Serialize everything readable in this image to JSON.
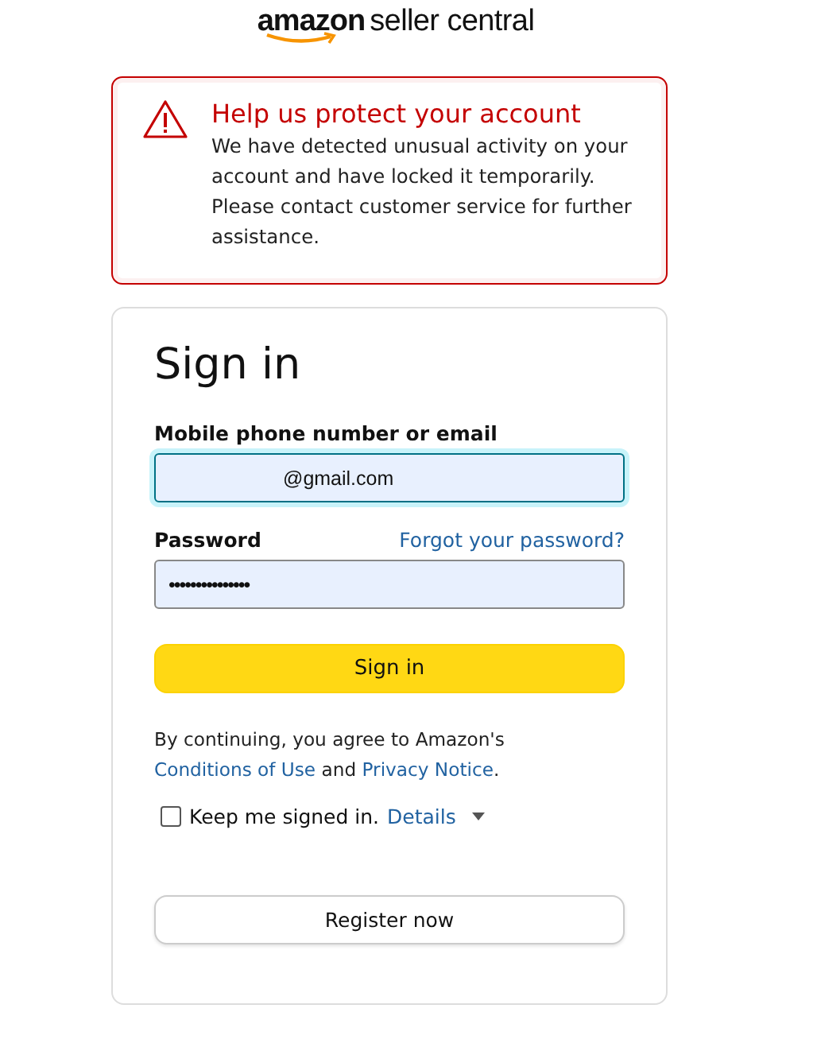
{
  "logo": {
    "brand": "amazon",
    "product": "seller central"
  },
  "alert": {
    "title": "Help us protect your account",
    "message": "We have detected unusual activity on your account and have locked it temporarily. Please contact customer service for further assistance."
  },
  "sign_in": {
    "heading": "Sign in",
    "email": {
      "label": "Mobile phone number or email",
      "value": "@gmail.com",
      "focused": true
    },
    "password": {
      "label": "Password",
      "value": "•••••••••••••••",
      "forgot_link": "Forgot your password?"
    },
    "submit": "Sign in",
    "legal": {
      "before": "By continuing, you agree to Amazon's ",
      "link_1": "Conditions of Use",
      "middle": " and ",
      "link_2": "Privacy Notice",
      "after": "."
    },
    "keep_signed_in": {
      "label": "Keep me signed in.",
      "checked": false,
      "details": "Details"
    },
    "register": "Register now"
  }
}
